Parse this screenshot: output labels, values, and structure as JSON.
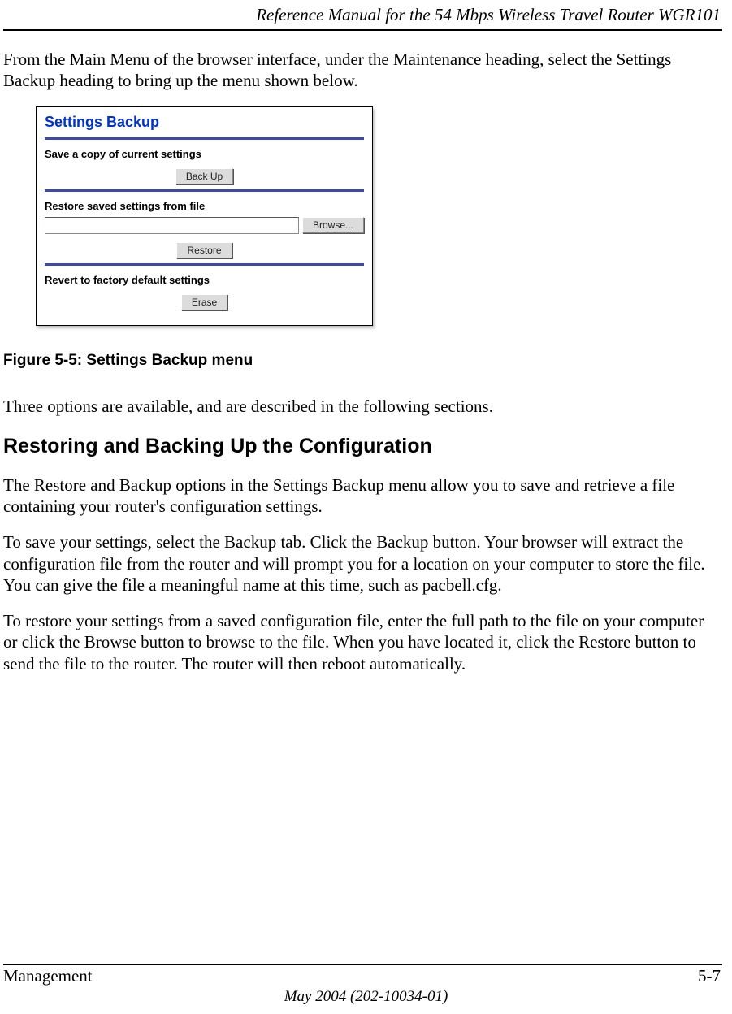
{
  "header": {
    "title": "Reference Manual for the 54 Mbps Wireless Travel Router WGR101"
  },
  "body": {
    "intro": "From the Main Menu of the browser interface, under the Maintenance heading, select the Settings Backup heading to bring up the menu shown below.",
    "figure": {
      "panel_title": "Settings Backup",
      "section1": "Save a copy of current settings",
      "backup_btn": "Back Up",
      "section2": "Restore saved settings from file",
      "browse_btn": "Browse...",
      "restore_btn": "Restore",
      "section3": "Revert to factory default settings",
      "erase_btn": "Erase"
    },
    "caption": "Figure 5-5:  Settings Backup menu",
    "para2": "Three options are available, and are described in the following sections.",
    "heading": "Restoring and Backing Up the Configuration",
    "para3": "The Restore and Backup options in the Settings Backup menu allow you to save and retrieve a file containing your router's configuration settings.",
    "para4": "To save your settings, select the Backup tab. Click the Backup button. Your browser will extract the configuration file from the router and will prompt you for a location on your computer to store the file. You can give the file a meaningful name at this time, such as pacbell.cfg.",
    "para5": "To restore your settings from a saved configuration file, enter the full path to the file on your computer or click the Browse button to browse to the file. When you have located it, click the Restore button to send the file to the router. The router will then reboot automatically."
  },
  "footer": {
    "left": "Management",
    "right": "5-7",
    "date": "May 2004 (202-10034-01)"
  }
}
